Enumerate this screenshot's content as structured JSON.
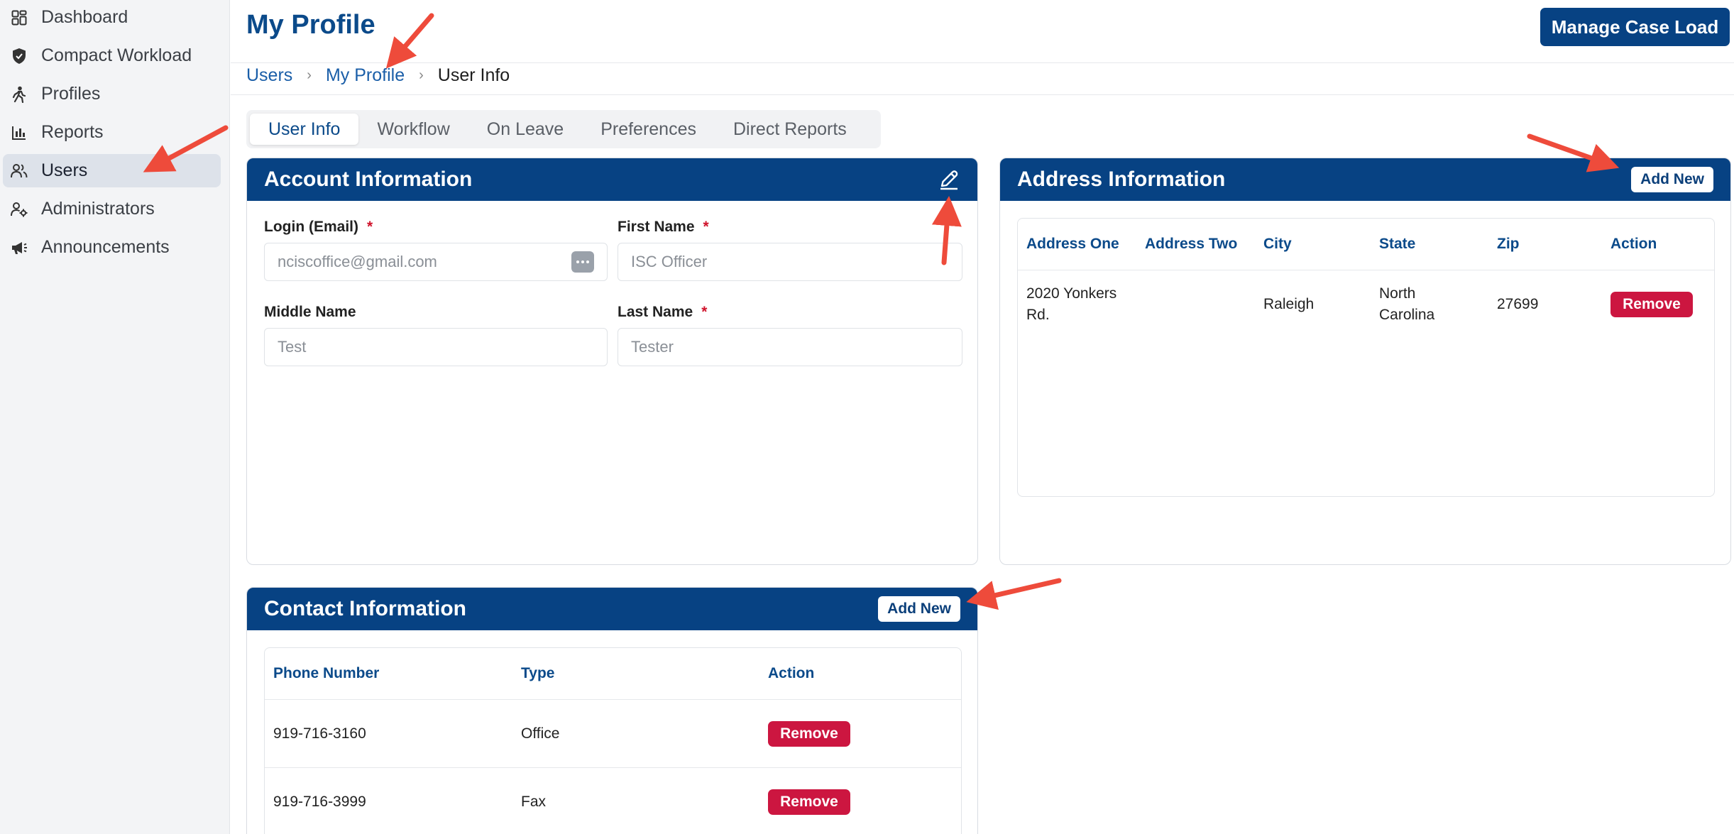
{
  "sidebar": {
    "items": [
      {
        "label": "Dashboard",
        "icon": "dashboard-icon"
      },
      {
        "label": "Compact Workload",
        "icon": "shield-icon"
      },
      {
        "label": "Profiles",
        "icon": "person-walking-icon"
      },
      {
        "label": "Reports",
        "icon": "bar-chart-icon"
      },
      {
        "label": "Users",
        "icon": "users-icon",
        "active": true
      },
      {
        "label": "Administrators",
        "icon": "admin-icon"
      },
      {
        "label": "Announcements",
        "icon": "megaphone-icon"
      }
    ]
  },
  "header": {
    "title": "My Profile",
    "manage_label": "Manage Case Load"
  },
  "breadcrumb": {
    "items": [
      "Users",
      "My Profile",
      "User Info"
    ]
  },
  "tabs": [
    "User Info",
    "Workflow",
    "On Leave",
    "Preferences",
    "Direct Reports"
  ],
  "account": {
    "title": "Account Information",
    "fields": {
      "login": {
        "label": "Login (Email)",
        "required": "*",
        "value": "nciscoffice@gmail.com"
      },
      "first": {
        "label": "First Name",
        "required": "*",
        "value": "ISC Officer"
      },
      "middle": {
        "label": "Middle Name",
        "value": "Test"
      },
      "last": {
        "label": "Last Name",
        "required": "*",
        "value": "Tester"
      }
    }
  },
  "address": {
    "title": "Address Information",
    "add_label": "Add New",
    "columns": [
      "Address One",
      "Address Two",
      "City",
      "State",
      "Zip",
      "Action"
    ],
    "rows": [
      {
        "address_one": "2020 Yonkers Rd.",
        "address_two": "",
        "city": "Raleigh",
        "state": "North Carolina",
        "zip": "27699",
        "action": "Remove"
      }
    ]
  },
  "contact": {
    "title": "Contact Information",
    "add_label": "Add New",
    "columns": [
      "Phone Number",
      "Type",
      "Action"
    ],
    "rows": [
      {
        "phone": "919-716-3160",
        "type": "Office",
        "action": "Remove"
      },
      {
        "phone": "919-716-3999",
        "type": "Fax",
        "action": "Remove"
      }
    ]
  },
  "colors": {
    "primary": "#074283",
    "link": "#1a5ea8",
    "danger": "#cc1640",
    "annotation": "#ee4b3b"
  }
}
